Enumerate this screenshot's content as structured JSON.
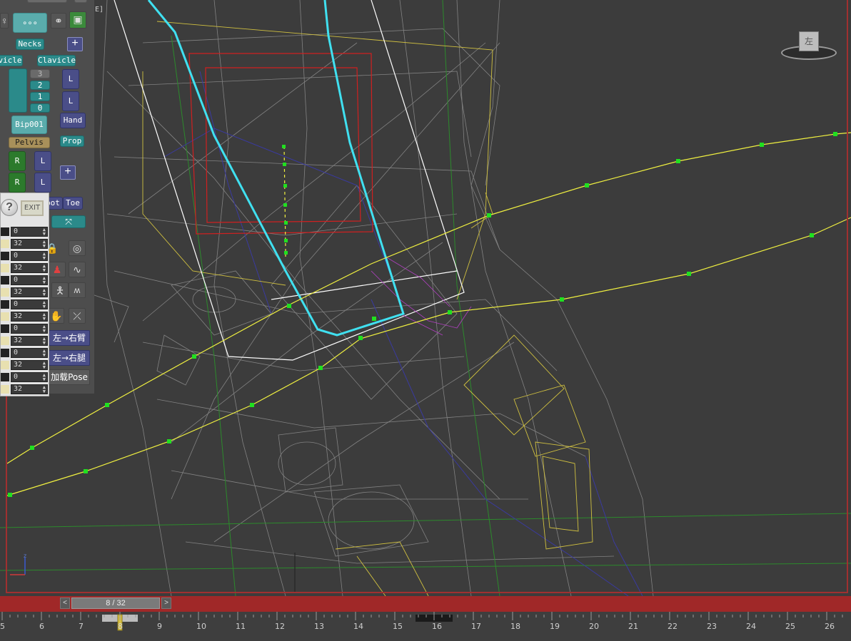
{
  "viewport": {
    "label": "E]",
    "viewcube_face": "左"
  },
  "panel": {
    "necks": "Necks",
    "clavicle_left": "vicle",
    "clavicle_right": "Clavicle",
    "spine": [
      "3",
      "2",
      "1",
      "0"
    ],
    "l1": "L",
    "l2": "L",
    "bip": "Bip001",
    "hand": "Hand",
    "pelvis": "Pelvis",
    "prop": "Prop",
    "r1": "R",
    "l3": "L",
    "r2": "R",
    "l4": "L",
    "foot": "oot",
    "toe": "Toe"
  },
  "popup": {
    "help_glyph": "?",
    "exit_label": "EXIT",
    "rows": [
      "0",
      "32",
      "0",
      "32",
      "0",
      "32",
      "0",
      "32",
      "0",
      "32",
      "0",
      "32",
      "0",
      "32"
    ]
  },
  "tools": {
    "mirror_arm": "左→右臂",
    "mirror_leg": "左→右腿",
    "load_pose": "加载Pose"
  },
  "trackbar": {
    "frame_text": "8 / 32",
    "prev": "<",
    "next": ">"
  },
  "timeline": {
    "ticks": [
      "5",
      "6",
      "7",
      "8",
      "9",
      "10",
      "11",
      "12",
      "13",
      "14",
      "15",
      "16",
      "17",
      "18",
      "19",
      "20",
      "21",
      "22",
      "23",
      "24",
      "25",
      "26"
    ]
  },
  "colors": {
    "viewport_border": "#a03030",
    "trackbar": "#a02828",
    "curve": "#f0f040",
    "key": "#20e020",
    "bone_selected": "#40e0f0"
  }
}
